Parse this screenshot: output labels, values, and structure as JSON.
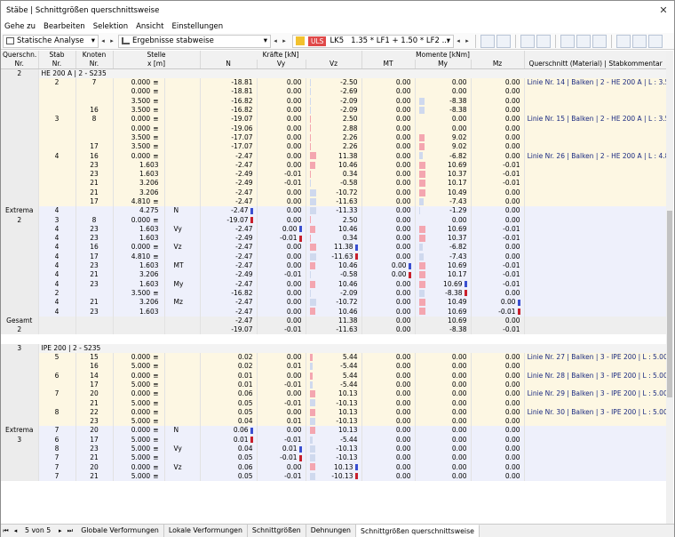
{
  "window": {
    "title": "Stäbe | Schnittgrößen querschnittsweise",
    "close": "✕"
  },
  "menu": [
    "Gehe zu",
    "Bearbeiten",
    "Selektion",
    "Ansicht",
    "Einstellungen"
  ],
  "toolbar": {
    "analysis": "Statische Analyse",
    "results": "Ergebnisse stabweise",
    "ls_badge": "ULS",
    "ls_id": "LK5",
    "combo": "1.35 * LF1 + 1.50 * LF2 ..."
  },
  "headers": {
    "qs": "Querschn.",
    "qs2": "Nr.",
    "stab": "Stab",
    "stab2": "Nr.",
    "knoten": "Knoten",
    "knoten2": "Nr.",
    "stelle": "Stelle",
    "stelle2": "x [m]",
    "kraefte": "Kräfte [kN]",
    "momente": "Momente [kNm]",
    "N": "N",
    "Vy": "Vy",
    "Vz": "Vz",
    "MT": "MT",
    "My": "My",
    "Mz": "Mz",
    "qs_kom": "Querschnitt (Material) | Stabkommentar"
  },
  "rows": [
    {
      "t": "grp",
      "c0": "2",
      "grp": "HE 200 A | 2 - S235"
    },
    {
      "t": "y",
      "c1": "2",
      "c2": "7",
      "x": "0.000",
      "eq": "≡",
      "N": "-18.81",
      "Vy": "0.00",
      "Vz": "-2.50",
      "MT": "0.00",
      "My": "0.00",
      "Mz": "0.00",
      "com": "Linie Nr. 14 | Balken | 2 - HE 200 A | L : 3.500 m"
    },
    {
      "t": "y",
      "x": "0.000",
      "eq": "≡",
      "N": "-18.81",
      "Vy": "0.00",
      "Vz": "-2.69",
      "MT": "0.00",
      "My": "0.00",
      "Mz": "0.00"
    },
    {
      "t": "y",
      "x": "3.500",
      "eq": "≡",
      "N": "-16.82",
      "Vy": "0.00",
      "Vz": "-2.09",
      "MT": "0.00",
      "My": "-8.38",
      "Mz": "0.00"
    },
    {
      "t": "y",
      "c2": "16",
      "x": "3.500",
      "eq": "≡",
      "N": "-16.82",
      "Vy": "0.00",
      "Vz": "-2.09",
      "MT": "0.00",
      "My": "-8.38",
      "Mz": "0.00"
    },
    {
      "t": "y",
      "c1": "3",
      "c2": "8",
      "x": "0.000",
      "eq": "≡",
      "N": "-19.07",
      "Vy": "0.00",
      "Vz": "2.50",
      "MT": "0.00",
      "My": "0.00",
      "Mz": "0.00",
      "com": "Linie Nr. 15 | Balken | 2 - HE 200 A | L : 3.500 m"
    },
    {
      "t": "y",
      "x": "0.000",
      "eq": "≡",
      "N": "-19.06",
      "Vy": "0.00",
      "Vz": "2.88",
      "MT": "0.00",
      "My": "0.00",
      "Mz": "0.00"
    },
    {
      "t": "y",
      "x": "3.500",
      "eq": "≡",
      "N": "-17.07",
      "Vy": "0.00",
      "Vz": "2.26",
      "MT": "0.00",
      "My": "9.02",
      "Mz": "0.00"
    },
    {
      "t": "y",
      "c2": "17",
      "x": "3.500",
      "eq": "≡",
      "N": "-17.07",
      "Vy": "0.00",
      "Vz": "2.26",
      "MT": "0.00",
      "My": "9.02",
      "Mz": "0.00"
    },
    {
      "t": "y",
      "c1": "4",
      "c2": "16",
      "x": "0.000",
      "eq": "≡",
      "N": "-2.47",
      "Vy": "0.00",
      "Vz": "11.38",
      "MT": "0.00",
      "My": "-6.82",
      "Mz": "0.00",
      "com": "Linie Nr. 26 | Balken | 2 - HE 200 A | L : 4.810 m"
    },
    {
      "t": "y",
      "c2": "23",
      "x": "1.603",
      "N": "-2.47",
      "Vy": "0.00",
      "Vz": "10.46",
      "MT": "0.00",
      "My": "10.69",
      "Mz": "-0.01"
    },
    {
      "t": "y",
      "c2": "23",
      "x": "1.603",
      "N": "-2.49",
      "Vy": "-0.01",
      "Vz": "0.34",
      "MT": "0.00",
      "My": "10.37",
      "Mz": "-0.01"
    },
    {
      "t": "y",
      "c2": "21",
      "x": "3.206",
      "N": "-2.49",
      "Vy": "-0.01",
      "Vz": "-0.58",
      "MT": "0.00",
      "My": "10.17",
      "Mz": "-0.01"
    },
    {
      "t": "y",
      "c2": "21",
      "x": "3.206",
      "N": "-2.47",
      "Vy": "0.00",
      "Vz": "-10.72",
      "MT": "0.00",
      "My": "10.49",
      "Mz": "0.00"
    },
    {
      "t": "y",
      "c2": "17",
      "x": "4.810",
      "eq": "≡",
      "N": "-2.47",
      "Vy": "0.00",
      "Vz": "-11.63",
      "MT": "0.00",
      "My": "-7.43",
      "Mz": "0.00"
    },
    {
      "t": "ex",
      "c0": "Extrema",
      "c1": "4",
      "x": "4.275",
      "lbl": "N",
      "N": "-2.47",
      "mN": "b",
      "Vy": "0.00",
      "Vz": "-11.33",
      "MT": "0.00",
      "My": "-1.29",
      "Mz": "0.00"
    },
    {
      "t": "ex",
      "c0": "2",
      "c1": "3",
      "c2": "8",
      "x": "0.000",
      "eq": "≡",
      "N": "-19.07",
      "mN": "r",
      "Vy": "0.00",
      "Vz": "2.50",
      "MT": "0.00",
      "My": "0.00",
      "Mz": "0.00"
    },
    {
      "t": "ex",
      "c1": "4",
      "c2": "23",
      "x": "1.603",
      "lbl": "Vy",
      "N": "-2.47",
      "Vy": "0.00",
      "mVy": "b",
      "Vz": "10.46",
      "MT": "0.00",
      "My": "10.69",
      "Mz": "-0.01"
    },
    {
      "t": "ex",
      "c1": "4",
      "c2": "23",
      "x": "1.603",
      "N": "-2.49",
      "Vy": "-0.01",
      "mVy": "r",
      "Vz": "0.34",
      "MT": "0.00",
      "My": "10.37",
      "Mz": "-0.01"
    },
    {
      "t": "ex",
      "c1": "4",
      "c2": "16",
      "x": "0.000",
      "eq": "≡",
      "lbl": "Vz",
      "N": "-2.47",
      "Vy": "0.00",
      "Vz": "11.38",
      "mVz": "b",
      "MT": "0.00",
      "My": "-6.82",
      "Mz": "0.00"
    },
    {
      "t": "ex",
      "c1": "4",
      "c2": "17",
      "x": "4.810",
      "eq": "≡",
      "N": "-2.47",
      "Vy": "0.00",
      "Vz": "-11.63",
      "mVz": "r",
      "MT": "0.00",
      "My": "-7.43",
      "Mz": "0.00"
    },
    {
      "t": "ex",
      "c1": "4",
      "c2": "23",
      "x": "1.603",
      "lbl": "MT",
      "N": "-2.47",
      "Vy": "0.00",
      "Vz": "10.46",
      "MT": "0.00",
      "mMT": "b",
      "My": "10.69",
      "Mz": "-0.01"
    },
    {
      "t": "ex",
      "c1": "4",
      "c2": "21",
      "x": "3.206",
      "N": "-2.49",
      "Vy": "-0.01",
      "Vz": "-0.58",
      "MT": "0.00",
      "mMT": "r",
      "My": "10.17",
      "Mz": "-0.01"
    },
    {
      "t": "ex",
      "c1": "4",
      "c2": "23",
      "x": "1.603",
      "lbl": "My",
      "N": "-2.47",
      "Vy": "0.00",
      "Vz": "10.46",
      "MT": "0.00",
      "My": "10.69",
      "mMy": "b",
      "Mz": "-0.01"
    },
    {
      "t": "ex",
      "c1": "2",
      "x": "3.500",
      "eq": "≡",
      "N": "-16.82",
      "Vy": "0.00",
      "Vz": "-2.09",
      "MT": "0.00",
      "My": "-8.38",
      "mMy": "r",
      "Mz": "0.00"
    },
    {
      "t": "ex",
      "c1": "4",
      "c2": "21",
      "x": "3.206",
      "lbl": "Mz",
      "N": "-2.47",
      "Vy": "0.00",
      "Vz": "-10.72",
      "MT": "0.00",
      "My": "10.49",
      "Mz": "0.00",
      "mMz": "b"
    },
    {
      "t": "ex",
      "c1": "4",
      "c2": "23",
      "x": "1.603",
      "N": "-2.47",
      "Vy": "0.00",
      "Vz": "10.46",
      "MT": "0.00",
      "My": "10.69",
      "Mz": "-0.01",
      "mMz": "r"
    },
    {
      "t": "tot",
      "c0": "Gesamt",
      "N": "-2.47",
      "Vy": "0.00",
      "Vz": "11.38",
      "MT": "0.00",
      "My": "10.69",
      "Mz": "0.00"
    },
    {
      "t": "tot",
      "c0": "2",
      "N": "-19.07",
      "Vy": "-0.01",
      "Vz": "-11.63",
      "MT": "0.00",
      "My": "-8.38",
      "Mz": "-0.01"
    },
    {
      "t": "blank"
    },
    {
      "t": "grp",
      "c0": "3",
      "grp": "IPE 200 | 2 - S235"
    },
    {
      "t": "y",
      "c1": "5",
      "c2": "15",
      "x": "0.000",
      "eq": "≡",
      "N": "0.02",
      "Vy": "0.00",
      "Vz": "5.44",
      "MT": "0.00",
      "My": "0.00",
      "Mz": "0.00",
      "com": "Linie Nr. 27 | Balken | 3 - IPE 200 | L : 5.000 m"
    },
    {
      "t": "y",
      "c2": "16",
      "x": "5.000",
      "eq": "≡",
      "N": "0.02",
      "Vy": "0.01",
      "Vz": "-5.44",
      "MT": "0.00",
      "My": "0.00",
      "Mz": "0.00"
    },
    {
      "t": "y",
      "c1": "6",
      "c2": "14",
      "x": "0.000",
      "eq": "≡",
      "N": "0.01",
      "Vy": "0.00",
      "Vz": "5.44",
      "MT": "0.00",
      "My": "0.00",
      "Mz": "0.00",
      "com": "Linie Nr. 28 | Balken | 3 - IPE 200 | L : 5.000 m"
    },
    {
      "t": "y",
      "c2": "17",
      "x": "5.000",
      "eq": "≡",
      "N": "0.01",
      "Vy": "-0.01",
      "Vz": "-5.44",
      "MT": "0.00",
      "My": "0.00",
      "Mz": "0.00"
    },
    {
      "t": "y",
      "c1": "7",
      "c2": "20",
      "x": "0.000",
      "eq": "≡",
      "N": "0.06",
      "Vy": "0.00",
      "Vz": "10.13",
      "MT": "0.00",
      "My": "0.00",
      "Mz": "0.00",
      "com": "Linie Nr. 29 | Balken | 3 - IPE 200 | L : 5.000 m"
    },
    {
      "t": "y",
      "c2": "21",
      "x": "5.000",
      "eq": "≡",
      "N": "0.05",
      "Vy": "-0.01",
      "Vz": "-10.13",
      "MT": "0.00",
      "My": "0.00",
      "Mz": "0.00"
    },
    {
      "t": "y",
      "c1": "8",
      "c2": "22",
      "x": "0.000",
      "eq": "≡",
      "N": "0.05",
      "Vy": "0.00",
      "Vz": "10.13",
      "MT": "0.00",
      "My": "0.00",
      "Mz": "0.00",
      "com": "Linie Nr. 30 | Balken | 3 - IPE 200 | L : 5.000 m"
    },
    {
      "t": "y",
      "c2": "23",
      "x": "5.000",
      "eq": "≡",
      "N": "0.04",
      "Vy": "0.01",
      "Vz": "-10.13",
      "MT": "0.00",
      "My": "0.00",
      "Mz": "0.00"
    },
    {
      "t": "ex",
      "c0": "Extrema",
      "c1": "7",
      "c2": "20",
      "x": "0.000",
      "eq": "≡",
      "lbl": "N",
      "N": "0.06",
      "mN": "b",
      "Vy": "0.00",
      "Vz": "10.13",
      "MT": "0.00",
      "My": "0.00",
      "Mz": "0.00"
    },
    {
      "t": "ex",
      "c0": "3",
      "c1": "6",
      "c2": "17",
      "x": "5.000",
      "eq": "≡",
      "N": "0.01",
      "mN": "r",
      "Vy": "-0.01",
      "Vz": "-5.44",
      "MT": "0.00",
      "My": "0.00",
      "Mz": "0.00"
    },
    {
      "t": "ex",
      "c1": "8",
      "c2": "23",
      "x": "5.000",
      "eq": "≡",
      "lbl": "Vy",
      "N": "0.04",
      "Vy": "0.01",
      "mVy": "b",
      "Vz": "-10.13",
      "MT": "0.00",
      "My": "0.00",
      "Mz": "0.00"
    },
    {
      "t": "ex",
      "c1": "7",
      "c2": "21",
      "x": "5.000",
      "eq": "≡",
      "N": "0.05",
      "Vy": "-0.01",
      "mVy": "r",
      "Vz": "-10.13",
      "MT": "0.00",
      "My": "0.00",
      "Mz": "0.00"
    },
    {
      "t": "ex",
      "c1": "7",
      "c2": "20",
      "x": "0.000",
      "eq": "≡",
      "lbl": "Vz",
      "N": "0.06",
      "Vy": "0.00",
      "Vz": "10.13",
      "mVz": "b",
      "MT": "0.00",
      "My": "0.00",
      "Mz": "0.00"
    },
    {
      "t": "ex",
      "c1": "7",
      "c2": "21",
      "x": "5.000",
      "eq": "≡",
      "N": "0.05",
      "Vy": "-0.01",
      "Vz": "-10.13",
      "mVz": "r",
      "MT": "0.00",
      "My": "0.00",
      "Mz": "0.00"
    }
  ],
  "status": {
    "page": "5 von 5"
  },
  "tabs": [
    "Globale Verformungen",
    "Lokale Verformungen",
    "Schnittgrößen",
    "Dehnungen",
    "Schnittgrößen querschnittsweise"
  ],
  "colors": {
    "pos_bar": "#f4a6b0",
    "neg_bar": "#cfd9ee",
    "max_marker": "#3a4fd0",
    "min_marker": "#c8202c"
  }
}
